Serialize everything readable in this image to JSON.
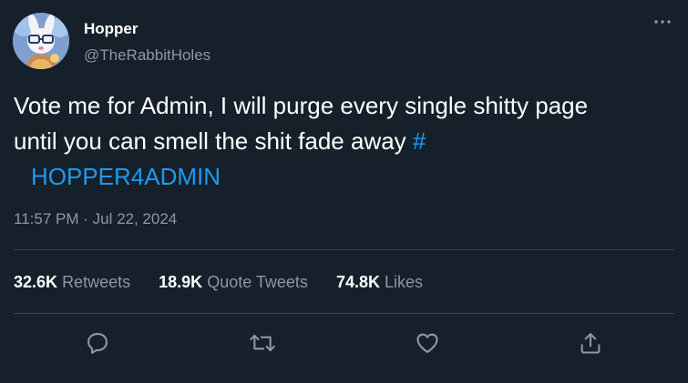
{
  "author": {
    "display_name": "Hopper",
    "handle": "@TheRabbitHoles",
    "avatar_icon": "rabbit-avatar"
  },
  "tweet": {
    "line1": "Vote me for Admin, I will purge every single shitty page",
    "line2": "until you can smell the shit fade away ",
    "hashtag_symbol": "#",
    "hashtag_text": "HOPPER4ADMIN",
    "timestamp": "11:57 PM · Jul 22, 2024"
  },
  "stats": {
    "retweets_count": "32.6K",
    "retweets_label": "Retweets",
    "quotes_count": "18.9K",
    "quotes_label": "Quote Tweets",
    "likes_count": "74.8K",
    "likes_label": "Likes"
  },
  "actions": {
    "icons": [
      "reply-icon",
      "retweet-icon",
      "like-icon",
      "share-icon"
    ]
  },
  "colors": {
    "background": "#15202b",
    "text": "#ffffff",
    "secondary": "#8b98a5",
    "link": "#1d9bf0",
    "divider": "#38444d"
  }
}
